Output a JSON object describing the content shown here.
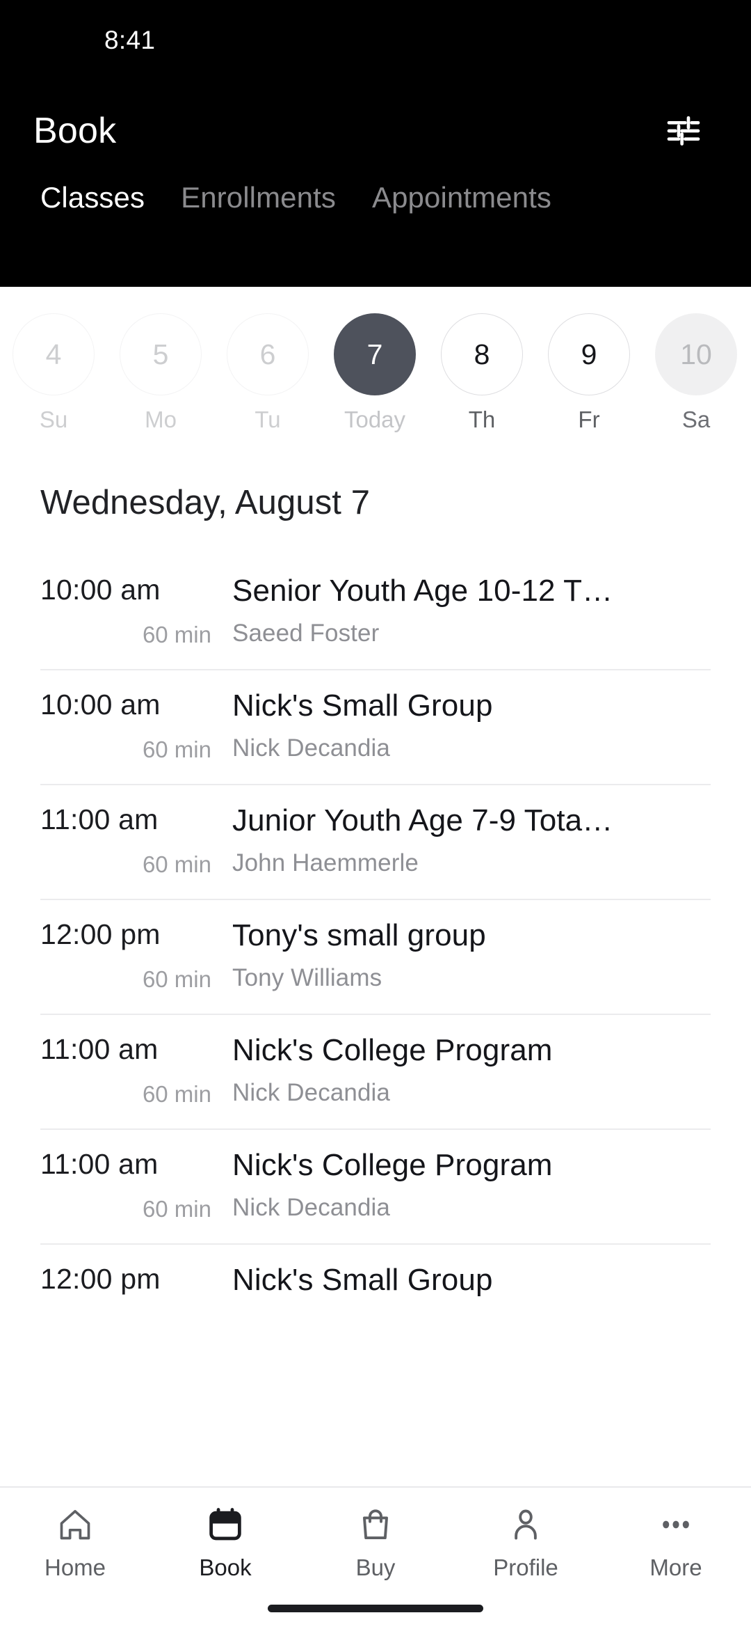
{
  "status_bar": {
    "time": "8:41"
  },
  "header": {
    "title": "Book",
    "filter_icon": "sliders-icon",
    "tabs": [
      {
        "label": "Classes",
        "active": true
      },
      {
        "label": "Enrollments",
        "active": false
      },
      {
        "label": "Appointments",
        "active": false
      }
    ]
  },
  "date_strip": {
    "days": [
      {
        "num": "4",
        "weekday": "Su",
        "state": "past"
      },
      {
        "num": "5",
        "weekday": "Mo",
        "state": "past"
      },
      {
        "num": "6",
        "weekday": "Tu",
        "state": "past"
      },
      {
        "num": "7",
        "weekday": "Today",
        "state": "today"
      },
      {
        "num": "8",
        "weekday": "Th",
        "state": "future"
      },
      {
        "num": "9",
        "weekday": "Fr",
        "state": "future"
      },
      {
        "num": "10",
        "weekday": "Sa",
        "state": "filled"
      }
    ]
  },
  "day_heading": "Wednesday, August 7",
  "classes": [
    {
      "time": "10:00 am",
      "duration": "60 min",
      "title": "Senior Youth Age 10-12 T…",
      "teacher": "Saeed Foster"
    },
    {
      "time": "10:00 am",
      "duration": "60 min",
      "title": "Nick's Small Group",
      "teacher": "Nick Decandia"
    },
    {
      "time": "11:00 am",
      "duration": "60 min",
      "title": "Junior Youth Age 7-9 Tota…",
      "teacher": "John Haemmerle"
    },
    {
      "time": "12:00 pm",
      "duration": "60 min",
      "title": "Tony's small group",
      "teacher": "Tony Williams"
    },
    {
      "time": "11:00 am",
      "duration": "60 min",
      "title": "Nick's College Program",
      "teacher": "Nick Decandia"
    },
    {
      "time": "11:00 am",
      "duration": "60 min",
      "title": "Nick's College Program",
      "teacher": "Nick Decandia"
    },
    {
      "time": "12:00 pm",
      "duration": "",
      "title": "Nick's Small Group",
      "teacher": ""
    }
  ],
  "bottom_nav": {
    "items": [
      {
        "label": "Home",
        "icon": "home-icon",
        "active": false
      },
      {
        "label": "Book",
        "icon": "calendar-icon",
        "active": true
      },
      {
        "label": "Buy",
        "icon": "bag-icon",
        "active": false
      },
      {
        "label": "Profile",
        "icon": "person-icon",
        "active": false
      },
      {
        "label": "More",
        "icon": "dots-icon",
        "active": false
      }
    ]
  },
  "colors": {
    "header_bg": "#000000",
    "today_circle": "#4e525c",
    "accent_text": "#ffffff",
    "muted_text": "#8e8f94",
    "divider": "#ebebed"
  }
}
